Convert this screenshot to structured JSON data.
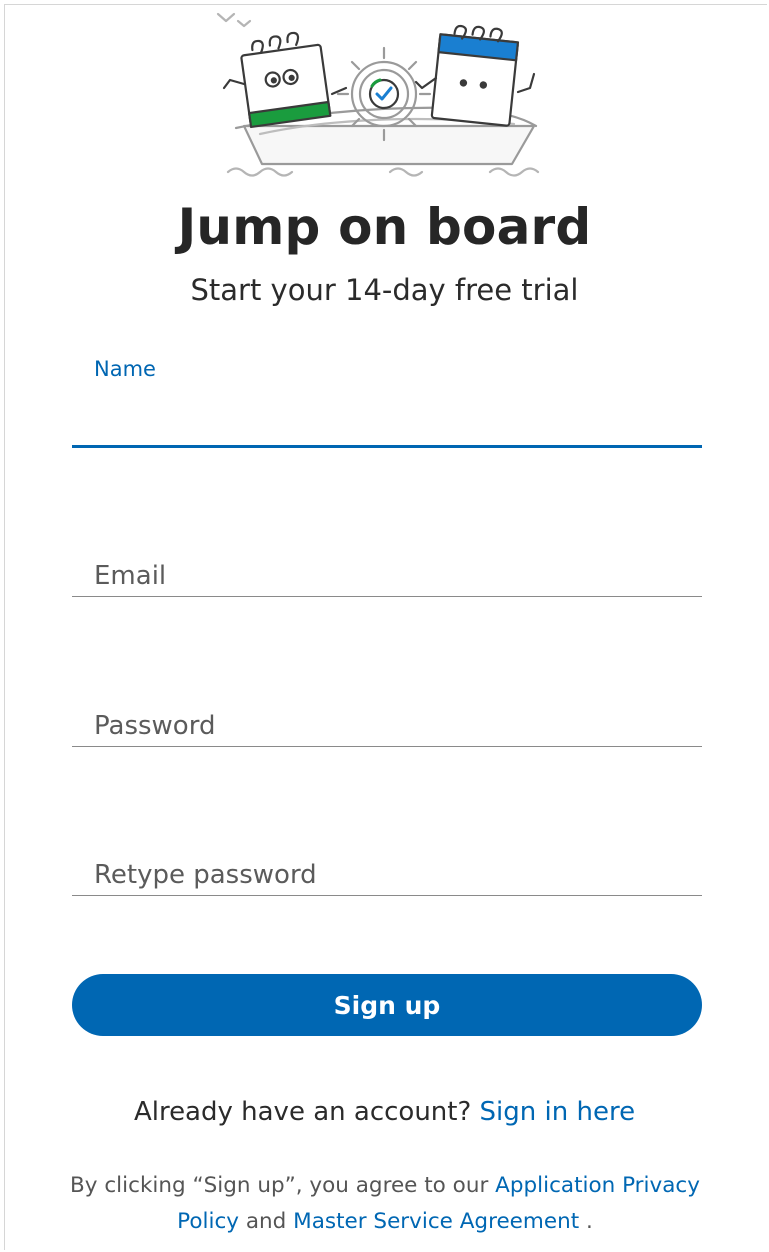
{
  "header": {
    "title": "Jump on board",
    "subtitle": "Start your 14-day free trial"
  },
  "form": {
    "name": {
      "label": "Name",
      "value": ""
    },
    "email": {
      "placeholder": "Email",
      "value": ""
    },
    "password": {
      "placeholder": "Password",
      "value": ""
    },
    "retype_password": {
      "placeholder": "Retype password",
      "value": ""
    },
    "submit_label": "Sign up"
  },
  "signin": {
    "prompt": "Already have an account?",
    "link_label": "Sign in here"
  },
  "legal": {
    "prefix": "By clicking “Sign up”, you agree to our",
    "privacy_link": "Application Privacy Policy",
    "conjunction": "and",
    "msa_link": "Master Service Agreement",
    "suffix": "."
  },
  "colors": {
    "accent": "#0067b3",
    "illustration_green": "#1a9c3e",
    "illustration_blue": "#1a7fd1",
    "text_dark": "#262626"
  },
  "icons": {
    "illustration": "boat-with-calendar-characters"
  }
}
